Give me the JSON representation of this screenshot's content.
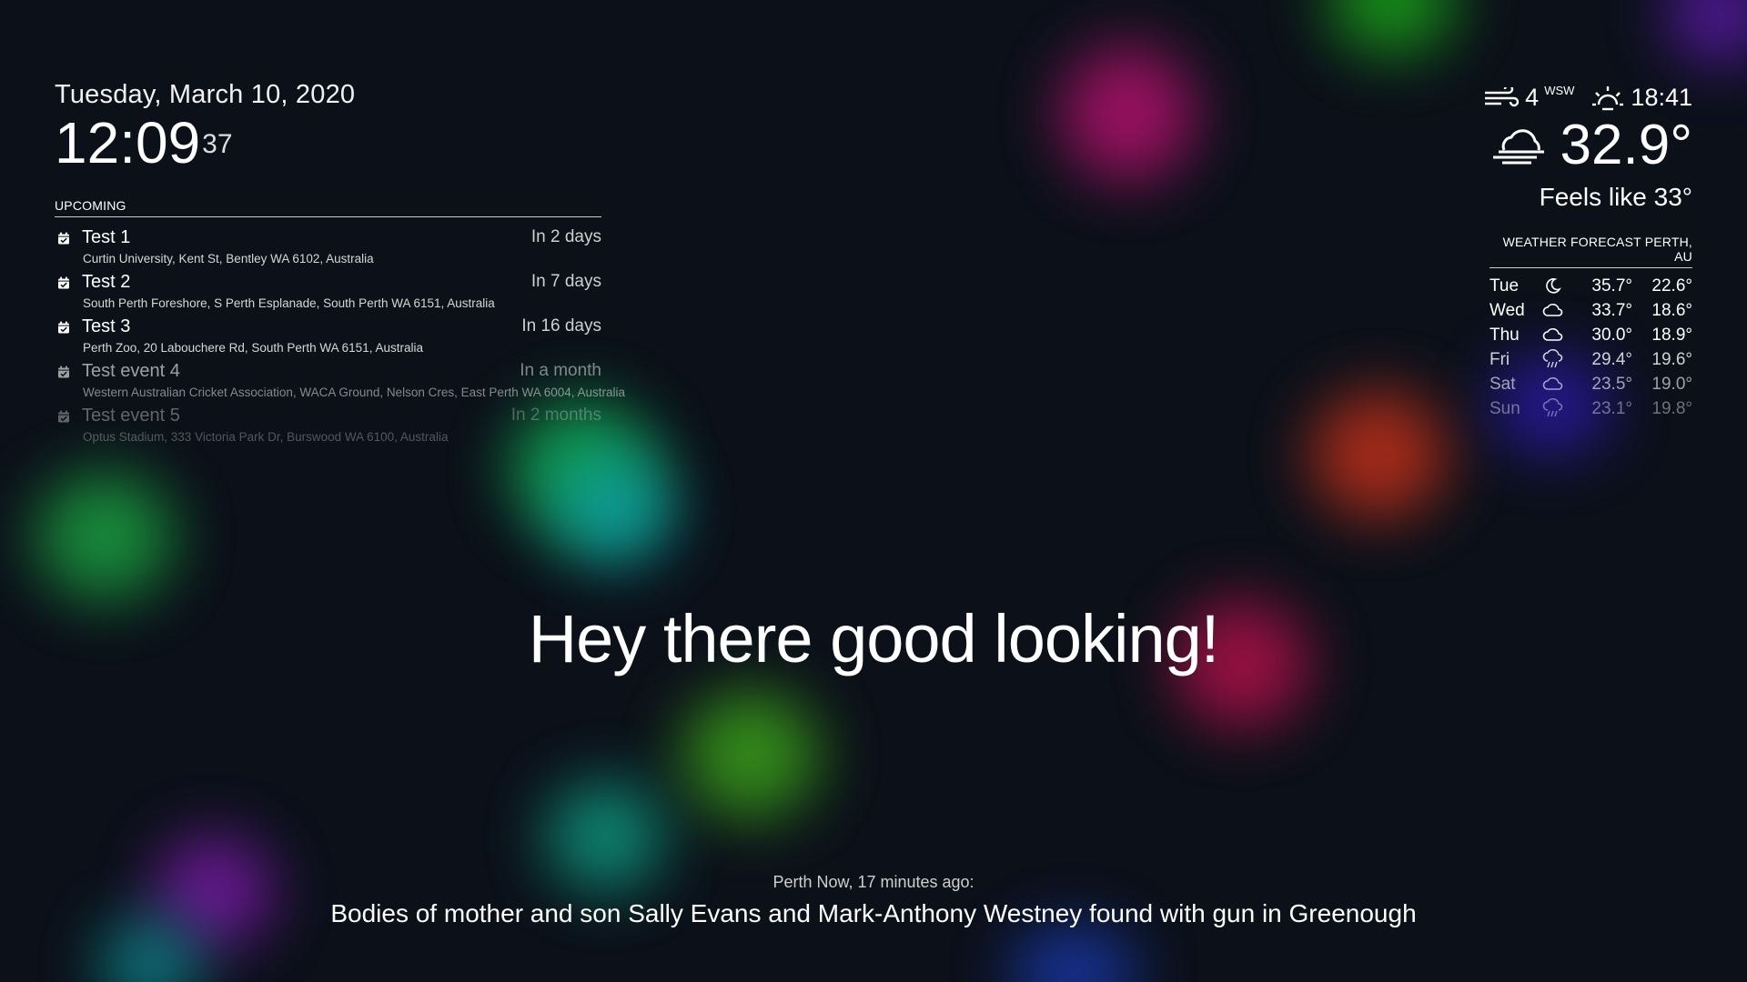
{
  "clock": {
    "date": "Tuesday, March 10, 2020",
    "time": "12:09",
    "seconds": "37"
  },
  "calendar": {
    "header": "UPCOMING",
    "events": [
      {
        "title": "Test 1",
        "relative": "In 2 days",
        "location": "Curtin University, Kent St, Bentley WA 6102, Australia",
        "opacity": 1.0
      },
      {
        "title": "Test 2",
        "relative": "In 7 days",
        "location": "South Perth Foreshore, S Perth Esplanade, South Perth WA 6151, Australia",
        "opacity": 1.0
      },
      {
        "title": "Test 3",
        "relative": "In 16 days",
        "location": "Perth Zoo, 20 Labouchere Rd, South Perth WA 6151, Australia",
        "opacity": 1.0
      },
      {
        "title": "Test event 4",
        "relative": "In a month",
        "location": "Western Australian Cricket Association, WACA Ground, Nelson Cres, East Perth WA 6004, Australia",
        "opacity": 0.6
      },
      {
        "title": "Test event 5",
        "relative": "In 2 months",
        "location": "Optus Stadium, 333 Victoria Park Dr, Burswood WA 6100, Australia",
        "opacity": 0.35
      }
    ]
  },
  "greeting": "Hey there good looking!",
  "news": {
    "source": "Perth Now, 17 minutes ago:",
    "headline": "Bodies of mother and son Sally Evans and Mark-Anthony Westney found with gun in Greenough"
  },
  "weather": {
    "wind_speed": "4",
    "wind_direction": "WSW",
    "sunset_time": "18:41",
    "temperature": "32.9°",
    "feels_like": "Feels like 33°",
    "icons": {
      "wind": "wind-icon",
      "sun": "sunset-icon",
      "current": "cloudy-windy-icon"
    }
  },
  "forecast": {
    "header": "WEATHER FORECAST PERTH, AU",
    "days": [
      {
        "day": "Tue",
        "icon": "moon-icon",
        "max": "35.7°",
        "min": "22.6°",
        "opacity": 1.0
      },
      {
        "day": "Wed",
        "icon": "cloud-icon",
        "max": "33.7°",
        "min": "18.6°",
        "opacity": 1.0
      },
      {
        "day": "Thu",
        "icon": "cloud-icon",
        "max": "30.0°",
        "min": "18.9°",
        "opacity": 1.0
      },
      {
        "day": "Fri",
        "icon": "rain-cloud-icon",
        "max": "29.4°",
        "min": "19.6°",
        "opacity": 0.8
      },
      {
        "day": "Sat",
        "icon": "cloud-icon",
        "max": "23.5°",
        "min": "19.0°",
        "opacity": 0.6
      },
      {
        "day": "Sun",
        "icon": "rain-cloud-icon",
        "max": "23.1°",
        "min": "19.8°",
        "opacity": 0.4
      }
    ]
  },
  "colors": {
    "background": "#0b1019",
    "text": "#ffffff",
    "dim_text": "#cfcfcf"
  }
}
